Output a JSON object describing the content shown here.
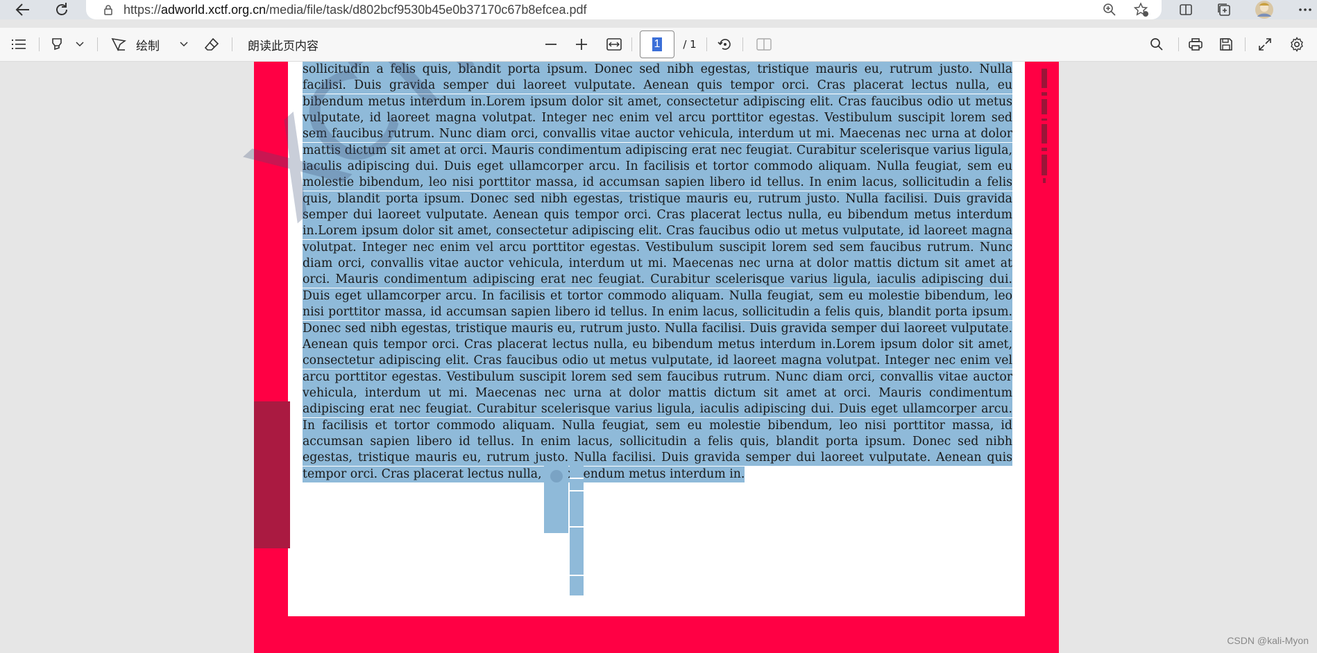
{
  "browser": {
    "url_prefix": "https://",
    "url_host": "adworld.xctf.org.cn",
    "url_path": "/media/file/task/d802bcf9530b45e0b37170c67b8efcea.pdf",
    "icons": [
      "back-icon",
      "refresh-icon",
      "lock-icon",
      "zoom-icon",
      "favorite-add-icon",
      "split-screen-icon",
      "collections-icon",
      "profile-avatar",
      "more-icon"
    ]
  },
  "pdf_toolbar": {
    "draw_label": "绘制",
    "read_aloud_label": "朗读此页内容",
    "page_current": "1",
    "page_total": "/ 1"
  },
  "document": {
    "body_text": "sollicitudin a felis quis, blandit porta ipsum. Donec sed nibh egestas, tristique mauris eu, rutrum justo. Nulla facilisi. Duis gravida semper dui laoreet vulputate. Aenean quis tempor orci. Cras placerat lectus nulla, eu bibendum metus interdum in.Lorem ipsum dolor sit amet, consectetur adipiscing elit. Cras faucibus odio ut metus vulputate, id laoreet magna volutpat. Integer nec enim vel arcu porttitor egestas. Vestibulum suscipit lorem sed sem faucibus rutrum. Nunc diam orci, convallis vitae auctor vehicula, interdum ut mi. Maecenas nec urna at dolor mattis dictum sit amet at orci. Mauris condimentum adipiscing erat nec feugiat. Curabitur scelerisque varius ligula, iaculis adipiscing dui. Duis eget ullamcorper arcu. In facilisis et tortor commodo aliquam. Nulla feugiat, sem eu molestie bibendum, leo nisi porttitor massa, id accumsan sapien libero id tellus. In enim lacus, sollicitudin a felis quis, blandit porta ipsum. Donec sed nibh egestas, tristique mauris eu, rutrum justo. Nulla facilisi. Duis gravida semper dui laoreet vulputate. Aenean quis tempor orci. Cras placerat lectus nulla, eu bibendum metus interdum in.Lorem ipsum dolor sit amet, consectetur adipiscing elit. Cras faucibus odio ut metus vulputate, id laoreet magna volutpat. Integer nec enim vel arcu porttitor egestas. Vestibulum suscipit lorem sed sem faucibus rutrum. Nunc diam orci, convallis vitae auctor vehicula, interdum ut mi. Maecenas nec urna at dolor mattis dictum sit amet at orci. Mauris condimentum adipiscing erat nec feugiat. Curabitur scelerisque varius ligula, iaculis adipiscing dui. Duis eget ullamcorper arcu. In facilisis et tortor commodo aliquam. Nulla feugiat, sem eu molestie bibendum, leo nisi porttitor massa, id accumsan sapien libero id tellus. In enim lacus, sollicitudin a felis quis, blandit porta ipsum. Donec sed nibh egestas, tristique mauris eu, rutrum justo. Nulla facilisi. Duis gravida semper dui laoreet vulputate. Aenean quis tempor orci. Cras placerat lectus nulla, eu bibendum metus interdum in.Lorem ipsum dolor sit amet, consectetur adipiscing elit. Cras faucibus odio ut metus vulputate, id laoreet magna volutpat. Integer nec enim vel arcu porttitor egestas. Vestibulum suscipit lorem sed sem faucibus rutrum. Nunc diam orci, convallis vitae auctor vehicula, interdum ut mi. Maecenas nec urna at dolor mattis dictum sit amet at orci. Mauris condimentum adipiscing erat nec feugiat. Curabitur scelerisque varius ligula, iaculis adipiscing dui. Duis eget ullamcorper arcu. In facilisis et tortor commodo aliquam. Nulla feugiat, sem eu molestie bibendum, leo nisi porttitor massa, id accumsan sapien libero id tellus. In enim lacus, sollicitudin a felis quis, blandit porta ipsum. Donec sed nibh egestas, tristique mauris eu, rutrum justo. Nulla facilisi. Duis gravida semper dui laoreet vulputate. Aenean quis tempor orci. Cras placerat lectus nulla, eu bibendum metus interdum in.",
    "watermark_text": "XCTF{",
    "page_color": "#ff0044",
    "selection_color": "#8fbad9"
  },
  "footer_credit": "CSDN @kali-Myon"
}
